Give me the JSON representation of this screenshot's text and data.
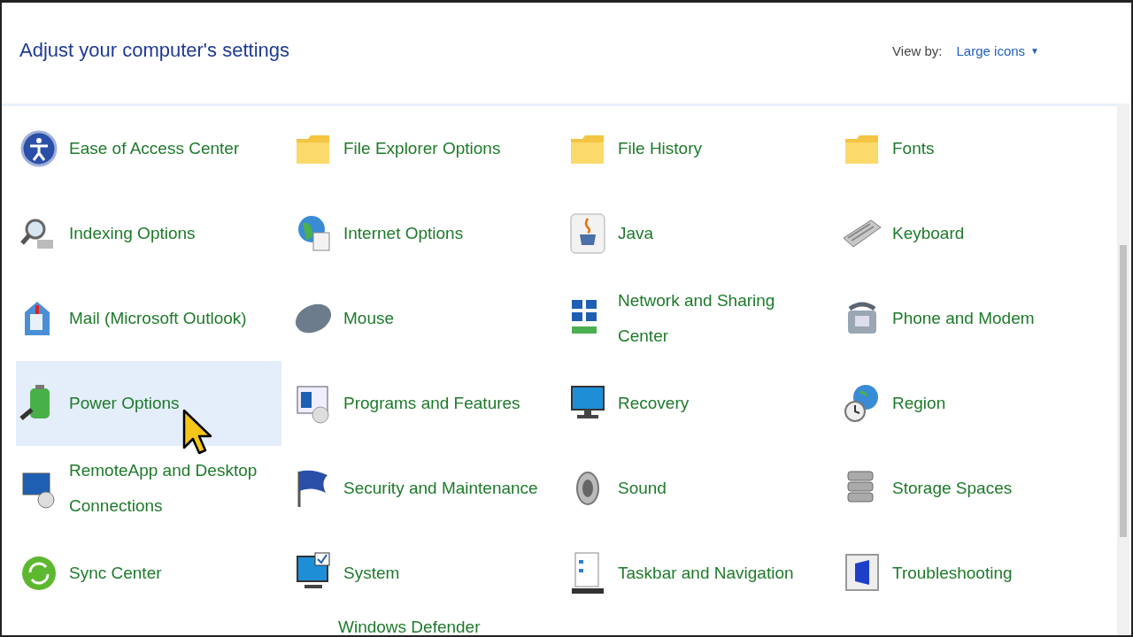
{
  "header": {
    "title": "Adjust your computer's settings",
    "view_by_label": "View by:",
    "view_by_value": "Large icons",
    "view_by_caret": "▼"
  },
  "items": [
    {
      "label": "Ease of Access Center",
      "selected": false
    },
    {
      "label": "File Explorer Options",
      "selected": false
    },
    {
      "label": "File History",
      "selected": false
    },
    {
      "label": "Fonts",
      "selected": false
    },
    {
      "label": "Indexing Options",
      "selected": false
    },
    {
      "label": "Internet Options",
      "selected": false
    },
    {
      "label": "Java",
      "selected": false
    },
    {
      "label": "Keyboard",
      "selected": false
    },
    {
      "label": "Mail (Microsoft Outlook)",
      "selected": false
    },
    {
      "label": "Mouse",
      "selected": false
    },
    {
      "label": "Network and Sharing Center",
      "selected": false
    },
    {
      "label": "Phone and Modem",
      "selected": false
    },
    {
      "label": "Power Options",
      "selected": true
    },
    {
      "label": "Programs and Features",
      "selected": false
    },
    {
      "label": "Recovery",
      "selected": false
    },
    {
      "label": "Region",
      "selected": false
    },
    {
      "label": "RemoteApp and Desktop Connections",
      "selected": false
    },
    {
      "label": "Security and Maintenance",
      "selected": false
    },
    {
      "label": "Sound",
      "selected": false
    },
    {
      "label": "Storage Spaces",
      "selected": false
    },
    {
      "label": "Sync Center",
      "selected": false
    },
    {
      "label": "System",
      "selected": false
    },
    {
      "label": "Taskbar and Navigation",
      "selected": false
    },
    {
      "label": "Troubleshooting",
      "selected": false
    }
  ],
  "partial_row": [
    {
      "label": "Windows Defender"
    }
  ]
}
